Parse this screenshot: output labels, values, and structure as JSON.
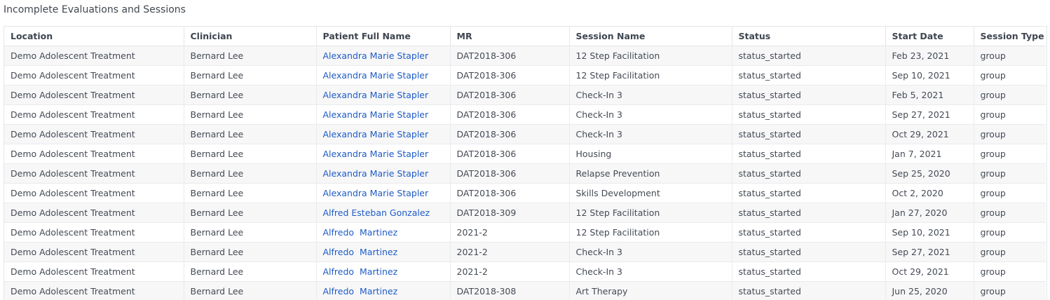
{
  "panel": {
    "title": "Incomplete Evaluations and Sessions"
  },
  "table": {
    "columns": [
      "Location",
      "Clinician",
      "Patient Full Name",
      "MR",
      "Session Name",
      "Status",
      "Start Date",
      "Session Type"
    ],
    "rows": [
      [
        "Demo Adolescent Treatment",
        "Bernard Lee",
        "Alexandra Marie Stapler",
        "DAT2018-306",
        "12 Step Facilitation",
        "status_started",
        "Feb 23, 2021",
        "group"
      ],
      [
        "Demo Adolescent Treatment",
        "Bernard Lee",
        "Alexandra Marie Stapler",
        "DAT2018-306",
        "12 Step Facilitation",
        "status_started",
        "Sep 10, 2021",
        "group"
      ],
      [
        "Demo Adolescent Treatment",
        "Bernard Lee",
        "Alexandra Marie Stapler",
        "DAT2018-306",
        "Check-In 3",
        "status_started",
        "Feb 5, 2021",
        "group"
      ],
      [
        "Demo Adolescent Treatment",
        "Bernard Lee",
        "Alexandra Marie Stapler",
        "DAT2018-306",
        "Check-In 3",
        "status_started",
        "Sep 27, 2021",
        "group"
      ],
      [
        "Demo Adolescent Treatment",
        "Bernard Lee",
        "Alexandra Marie Stapler",
        "DAT2018-306",
        "Check-In 3",
        "status_started",
        "Oct 29, 2021",
        "group"
      ],
      [
        "Demo Adolescent Treatment",
        "Bernard Lee",
        "Alexandra Marie Stapler",
        "DAT2018-306",
        "Housing",
        "status_started",
        "Jan 7, 2021",
        "group"
      ],
      [
        "Demo Adolescent Treatment",
        "Bernard Lee",
        "Alexandra Marie Stapler",
        "DAT2018-306",
        "Relapse Prevention",
        "status_started",
        "Sep 25, 2020",
        "group"
      ],
      [
        "Demo Adolescent Treatment",
        "Bernard Lee",
        "Alexandra Marie Stapler",
        "DAT2018-306",
        "Skills Development",
        "status_started",
        "Oct 2, 2020",
        "group"
      ],
      [
        "Demo Adolescent Treatment",
        "Bernard Lee",
        "Alfred Esteban Gonzalez",
        "DAT2018-309",
        "12 Step Facilitation",
        "status_started",
        "Jan 27, 2020",
        "group"
      ],
      [
        "Demo Adolescent Treatment",
        "Bernard Lee",
        "Alfredo  Martinez",
        "2021-2",
        "12 Step Facilitation",
        "status_started",
        "Sep 10, 2021",
        "group"
      ],
      [
        "Demo Adolescent Treatment",
        "Bernard Lee",
        "Alfredo  Martinez",
        "2021-2",
        "Check-In 3",
        "status_started",
        "Sep 27, 2021",
        "group"
      ],
      [
        "Demo Adolescent Treatment",
        "Bernard Lee",
        "Alfredo  Martinez",
        "2021-2",
        "Check-In 3",
        "status_started",
        "Oct 29, 2021",
        "group"
      ],
      [
        "Demo Adolescent Treatment",
        "Bernard Lee",
        "Alfredo  Martinez",
        "DAT2018-308",
        "Art Therapy",
        "status_started",
        "Jun 25, 2020",
        "group"
      ]
    ]
  },
  "colors": {
    "link": "#1e5bc6",
    "text": "#444a53",
    "stripe": "#f7f7f8",
    "border": "#e4e6e9"
  }
}
